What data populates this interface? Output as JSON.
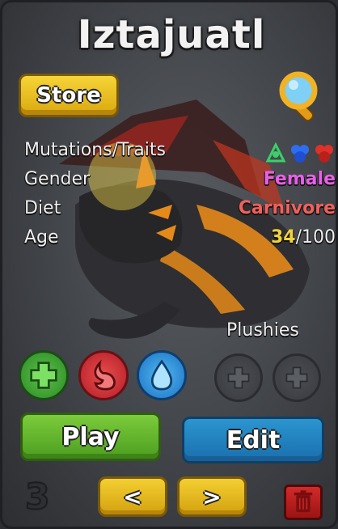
{
  "creature": {
    "name": "Iztajuatl"
  },
  "toolbar": {
    "store_label": "Store",
    "search_icon": "magnifier-icon"
  },
  "stats": {
    "mutations_label": "Mutations/Traits",
    "mutation_icons": [
      "green-trait-icon",
      "blue-trait-icon",
      "red-trait-icon"
    ],
    "gender_label": "Gender",
    "gender_value": "Female",
    "diet_label": "Diet",
    "diet_value": "Carnivore",
    "age_label": "Age",
    "age_current": "34",
    "age_max": "/100"
  },
  "care": {
    "feed_icon": "plus-icon",
    "food_icon": "stomach-icon",
    "water_icon": "water-drop-icon"
  },
  "plushies": {
    "label": "Plushies",
    "slots": [
      "empty",
      "empty"
    ]
  },
  "actions": {
    "play_label": "Play",
    "edit_label": "Edit"
  },
  "pager": {
    "slot_number": "3",
    "prev_label": "<",
    "next_label": ">",
    "trash_icon": "trash-icon"
  },
  "colors": {
    "gender": "#e860e8",
    "diet": "#f0615c",
    "age": "#f1d23c",
    "store": "#f6d437",
    "play": "#7ccb3c",
    "edit": "#2b95cf",
    "delete": "#d22a2a"
  }
}
